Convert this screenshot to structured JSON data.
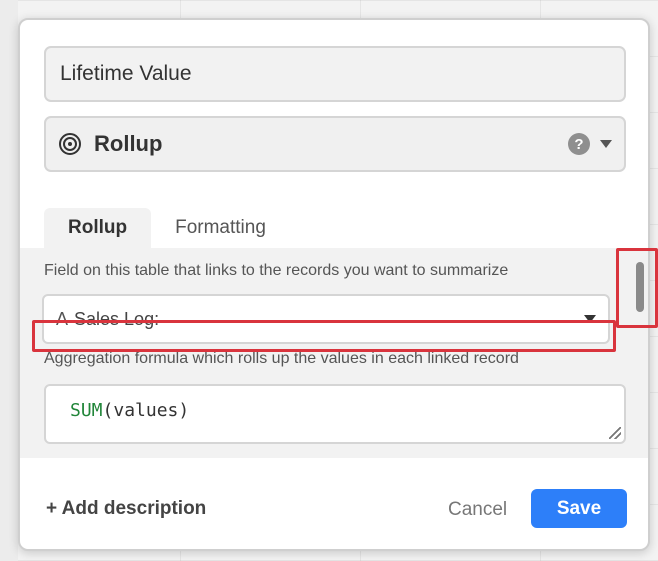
{
  "dialog": {
    "field_name": {
      "value": "Lifetime Value",
      "placeholder": ""
    },
    "field_type": {
      "label": "Rollup",
      "icon": "rollup-icon",
      "help_icon": "help-icon",
      "help_glyph": "?"
    },
    "tabs": [
      {
        "label": "Rollup",
        "active": true
      },
      {
        "label": "Formatting",
        "active": false
      }
    ],
    "rollup": {
      "link_field_label": "Field on this table that links to the records you want to summarize",
      "link_field_value": "Sales Log:",
      "link_field_icon": "A",
      "aggregation_label": "Aggregation formula which rolls up the values in each linked record",
      "formula_fn": "SUM",
      "formula_args": "(values)"
    },
    "footer": {
      "add_description": "+ Add description",
      "cancel_label": "Cancel",
      "save_label": "Save"
    }
  },
  "colors": {
    "accent": "#2d7ff9",
    "highlight": "#d9343d",
    "formula_function": "#22863a"
  }
}
